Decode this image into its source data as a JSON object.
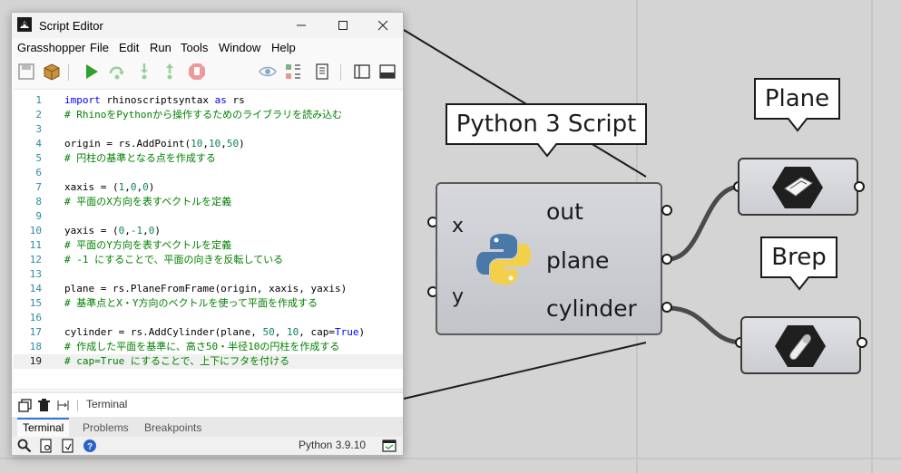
{
  "window": {
    "title": "Script Editor",
    "menu": [
      "Grasshopper",
      "File",
      "Edit",
      "Run",
      "Tools",
      "Window",
      "Help"
    ]
  },
  "code": {
    "lines": [
      {
        "n": "1",
        "text": "import rhinoscriptsyntax as rs"
      },
      {
        "n": "2",
        "text": "# RhinoをPythonから操作するためのライブラリを読み込む"
      },
      {
        "n": "3",
        "text": ""
      },
      {
        "n": "4",
        "text": "origin = rs.AddPoint(10,10,50)"
      },
      {
        "n": "5",
        "text": "# 円柱の基準となる点を作成する"
      },
      {
        "n": "6",
        "text": ""
      },
      {
        "n": "7",
        "text": "xaxis = (1,0,0)"
      },
      {
        "n": "8",
        "text": "# 平面のX方向を表すベクトルを定義"
      },
      {
        "n": "9",
        "text": ""
      },
      {
        "n": "10",
        "text": "yaxis = (0,-1,0)"
      },
      {
        "n": "11",
        "text": "# 平面のY方向を表すベクトルを定義"
      },
      {
        "n": "12",
        "text": "# -1 にすることで、平面の向きを反転している"
      },
      {
        "n": "13",
        "text": ""
      },
      {
        "n": "14",
        "text": "plane = rs.PlaneFromFrame(origin, xaxis, yaxis)"
      },
      {
        "n": "15",
        "text": "# 基準点とX・Y方向のベクトルを使って平面を作成する"
      },
      {
        "n": "16",
        "text": ""
      },
      {
        "n": "17",
        "text": "cylinder = rs.AddCylinder(plane, 50, 10, cap=True)"
      },
      {
        "n": "18",
        "text": "# 作成した平面を基準に、高さ50・半径10の円柱を作成する"
      },
      {
        "n": "19",
        "text": "# cap=True にすることで、上下にフタを付ける"
      }
    ],
    "active_line": "19"
  },
  "terminal": {
    "label": "Terminal"
  },
  "tabs": [
    "Terminal",
    "Problems",
    "Breakpoints"
  ],
  "status": {
    "python_version": "Python 3.9.10"
  },
  "canvas": {
    "component_tag": "Python 3 Script",
    "inputs": [
      "x",
      "y"
    ],
    "outputs": [
      "out",
      "plane",
      "cylinder"
    ],
    "plane_tag": "Plane",
    "brep_tag": "Brep"
  },
  "colors": {
    "keyword": "#0000ff",
    "comment": "#008000",
    "line_number": "#2b8aa8",
    "tab_accent": "#2a7bd4"
  }
}
